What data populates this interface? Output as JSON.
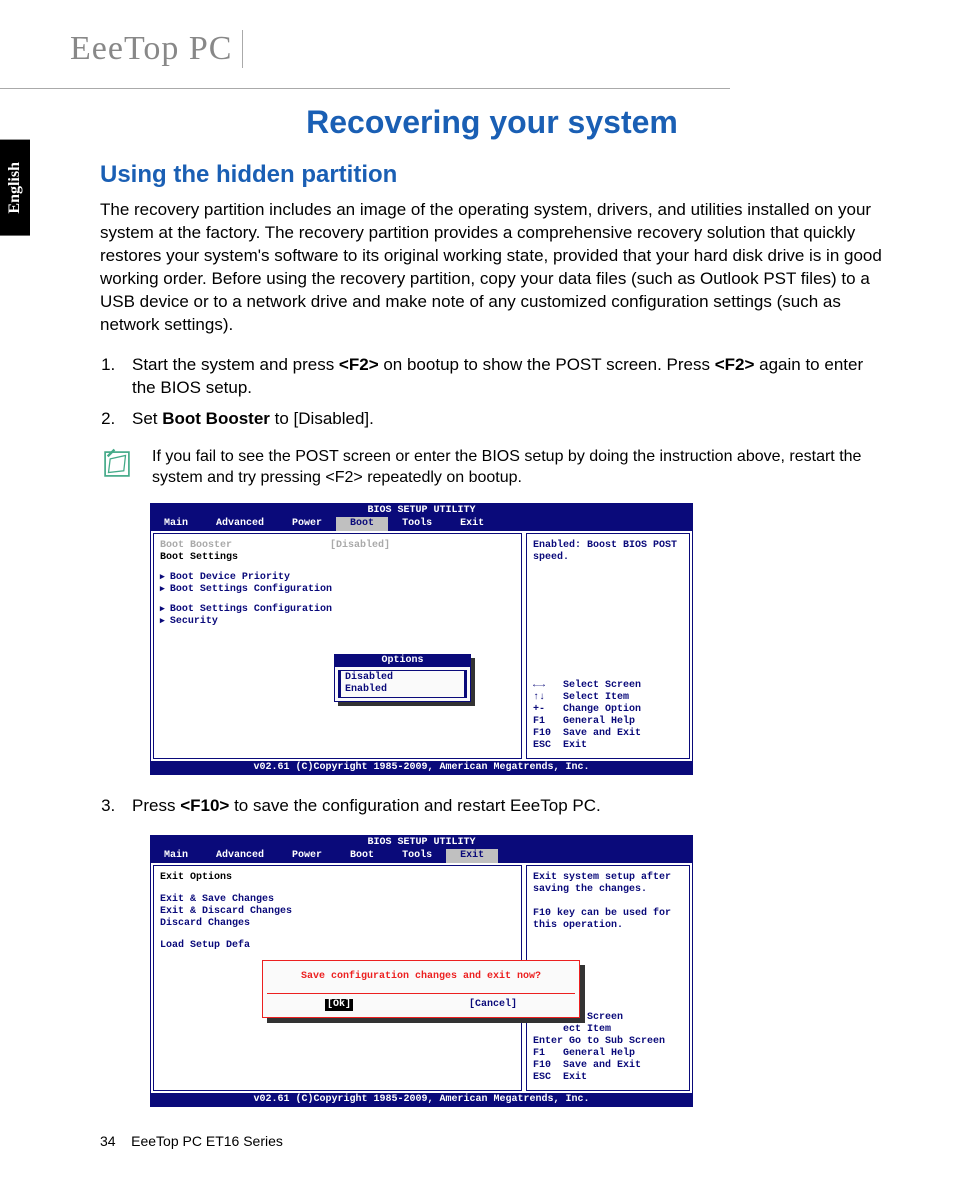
{
  "header": {
    "logo": "EeeTop PC",
    "language_tab": "English"
  },
  "page_title": "Recovering your system",
  "section_title": "Using the hidden partition",
  "intro_paragraph": "The recovery partition includes an image of the operating system, drivers, and utilities installed on your system at the factory. The recovery partition provides a comprehensive recovery solution that quickly restores your system's software to its original working state, provided that your hard disk drive is in good working order. Before using the recovery partition, copy your data files (such as Outlook PST files) to a USB device or to a network drive and make note of any customized configuration settings (such as network settings).",
  "steps": {
    "s1_pre": "Start the system and press ",
    "s1_key1": "<F2>",
    "s1_mid": " on bootup to show the POST screen. Press ",
    "s1_key2": "<F2>",
    "s1_post": " again to enter the BIOS setup.",
    "s2_pre": "Set ",
    "s2_bold": "Boot Booster",
    "s2_post": " to [Disabled].",
    "s3_pre": "Press ",
    "s3_key": "<F10>",
    "s3_post": " to save the configuration and restart EeeTop PC."
  },
  "note_text": "If you fail to see the POST screen or enter the BIOS setup by doing the instruction above, restart the system and try pressing <F2> repeatedly on bootup.",
  "bios1": {
    "title": "BIOS SETUP UTILITY",
    "tabs": [
      "Main",
      "Advanced",
      "Power",
      "Boot",
      "Tools",
      "Exit"
    ],
    "selected_tab": "Boot",
    "field_label": "Boot Booster",
    "field_value": "[Disabled]",
    "subheader": "Boot Settings",
    "submenus": [
      "Boot Device Priority",
      "Boot Settings Configuration",
      "Boot Settings Configuration",
      "Security"
    ],
    "options_title": "Options",
    "options": [
      "Disabled",
      "Enabled"
    ],
    "help_desc": "Enabled: Boost BIOS POST speed.",
    "help_keys": [
      "←→   Select Screen",
      "↑↓   Select Item",
      "+-   Change Option",
      "F1   General Help",
      "F10  Save and Exit",
      "ESC  Exit"
    ],
    "footer": "v02.61 (C)Copyright 1985-2009, American Megatrends, Inc."
  },
  "bios2": {
    "title": "BIOS SETUP UTILITY",
    "tabs": [
      "Main",
      "Advanced",
      "Power",
      "Boot",
      "Tools",
      "Exit"
    ],
    "selected_tab": "Exit",
    "subheader": "Exit Options",
    "submenus": [
      "Exit & Save Changes",
      "Exit & Discard Changes",
      "Discard Changes",
      "",
      "Load Setup Defa"
    ],
    "dialog_text": "Save configuration changes and exit now?",
    "dialog_ok": "[Ok]",
    "dialog_cancel": "[Cancel]",
    "help_desc": "Exit system setup after saving the changes.\n\nF10 key can be used for this operation.",
    "help_keys": [
      "     ect Screen",
      "     ect Item",
      "Enter Go to Sub Screen",
      "F1   General Help",
      "F10  Save and Exit",
      "ESC  Exit"
    ],
    "footer": "v02.61 (C)Copyright 1985-2009, American Megatrends, Inc."
  },
  "footer": {
    "page_num": "34",
    "doc_title": "EeeTop PC ET16 Series"
  }
}
